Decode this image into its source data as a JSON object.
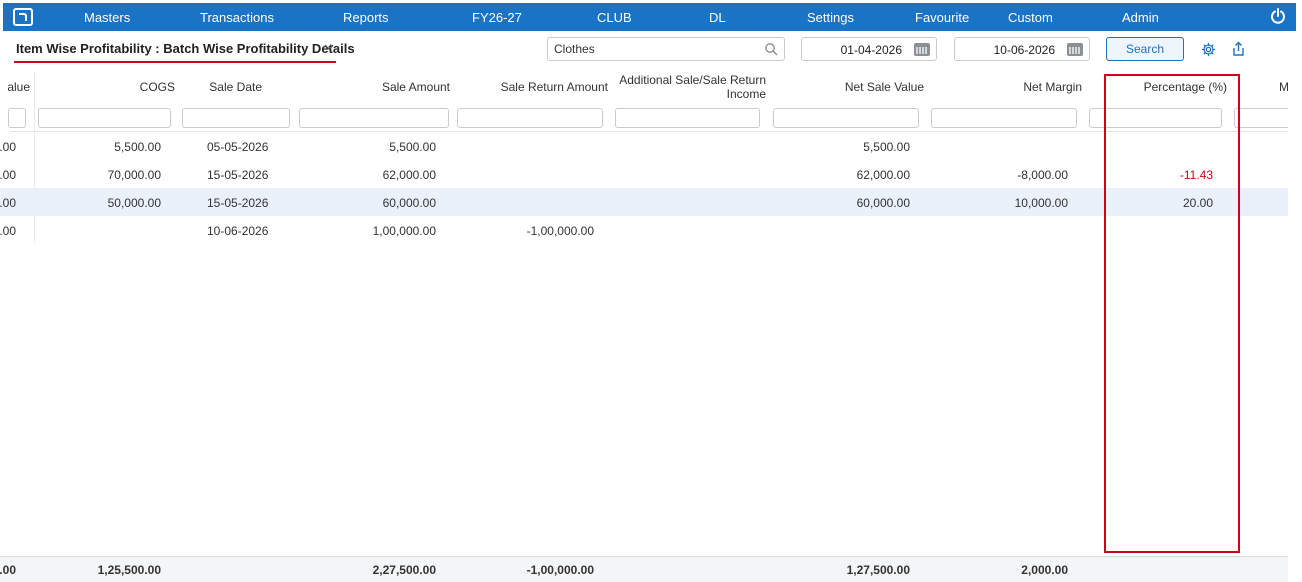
{
  "nav": {
    "items": [
      "Masters",
      "Transactions",
      "Reports",
      "FY26-27",
      "CLUB",
      "DL",
      "Settings",
      "Favourite",
      "Custom",
      "Admin"
    ]
  },
  "toolbar": {
    "report_title": "Item Wise Profitability : Batch Wise Profitability Details",
    "search_value": "Clothes",
    "from_date": "01-04-2026",
    "to_date": "10-06-2026",
    "search_label": "Search"
  },
  "table": {
    "headers": {
      "value": "alue",
      "cogs": "COGS",
      "sale_date": "Sale Date",
      "sale_amount": "Sale Amount",
      "sale_return_amount": "Sale Return Amount",
      "additional_line1": "Additional Sale/Sale Return",
      "additional_line2": "Income",
      "net_sale_value": "Net Sale Value",
      "net_margin": "Net Margin",
      "percentage": "Percentage (%)",
      "next": "M"
    },
    "rows": [
      {
        "value": ").00",
        "cogs": "5,500.00",
        "sale_date": "05-05-2026",
        "sale_amount": "5,500.00",
        "sale_return_amount": "",
        "additional": "",
        "net_sale_value": "5,500.00",
        "net_margin": "",
        "percentage": ""
      },
      {
        "value": ").00",
        "cogs": "70,000.00",
        "sale_date": "15-05-2026",
        "sale_amount": "62,000.00",
        "sale_return_amount": "",
        "additional": "",
        "net_sale_value": "62,000.00",
        "net_margin": "-8,000.00",
        "percentage": "-11.43"
      },
      {
        "value": ").00",
        "cogs": "50,000.00",
        "sale_date": "15-05-2026",
        "sale_amount": "60,000.00",
        "sale_return_amount": "",
        "additional": "",
        "net_sale_value": "60,000.00",
        "net_margin": "10,000.00",
        "percentage": "20.00"
      },
      {
        "value": ").00",
        "cogs": "",
        "sale_date": "10-06-2026",
        "sale_amount": "1,00,000.00",
        "sale_return_amount": "-1,00,000.00",
        "additional": "",
        "net_sale_value": "",
        "net_margin": "",
        "percentage": ""
      }
    ],
    "totals": {
      "value": ").00",
      "cogs": "1,25,500.00",
      "sale_amount": "2,27,500.00",
      "sale_return_amount": "-1,00,000.00",
      "net_sale_value": "1,27,500.00",
      "net_margin": "2,000.00"
    }
  },
  "colors": {
    "brand": "#1a73c5",
    "highlight": "#d0021b",
    "selected_row": "#eaf1fb",
    "negative": "#d0021b"
  }
}
